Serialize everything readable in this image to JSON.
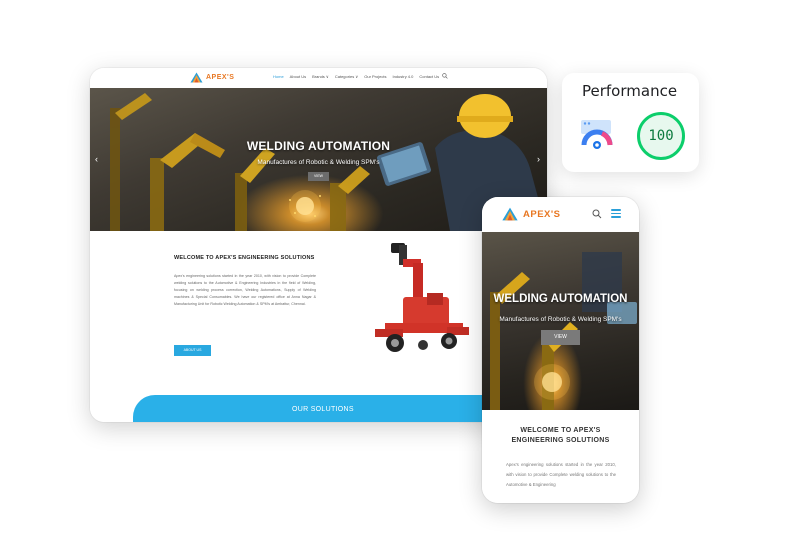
{
  "colors": {
    "accent": "#2ab0e8",
    "logo_orange": "#e87722",
    "score_green": "#0cce6b"
  },
  "desktop": {
    "logo_text": "APEX'S",
    "nav": [
      {
        "label": "Home",
        "active": true
      },
      {
        "label": "About Us"
      },
      {
        "label": "Brands ∨"
      },
      {
        "label": "Categories ∨"
      },
      {
        "label": "Our Projects"
      },
      {
        "label": "Industry 4.0"
      },
      {
        "label": "Contact Us"
      }
    ],
    "hero": {
      "title": "WELDING AUTOMATION",
      "subtitle": "Manufactures of Robotic & Welding SPM's",
      "button": "VIEW",
      "prev_icon": "chevron-left-icon",
      "next_icon": "chevron-right-icon"
    },
    "welcome_heading": "WELCOME TO APEX'S ENGINEERING SOLUTIONS",
    "welcome_paragraph": "Apex's engineering solutions started in the year 2010, with vision to provide Complete welding solutions to the Automotive & Engineering Industries in the field of Welding, focusing on welding process correction, Welding Automations, Supply of Welding machines & Special Consumables. We have our registered office at Anna Nagar & Manufacturing Unit for Robotic Welding Automation & SPM's at Ambattur, Chennai.",
    "about_button": "ABOUT US",
    "solutions_label": "OUR SOLUTIONS"
  },
  "performance": {
    "title": "Performance",
    "score": "100",
    "icon": "gauge-icon"
  },
  "mobile": {
    "logo_text": "APEX'S",
    "hero": {
      "title": "WELDING AUTOMATION",
      "subtitle": "Manufactures of Robotic & Welding SPM's",
      "button": "VIEW"
    },
    "welcome_line1": "WELCOME TO APEX'S",
    "welcome_line2": "ENGINEERING SOLUTIONS",
    "paragraph": "Apex's engineering solutions started in the year 2010, with vision to provide Complete welding solutions to the Automotive & Engineering"
  }
}
